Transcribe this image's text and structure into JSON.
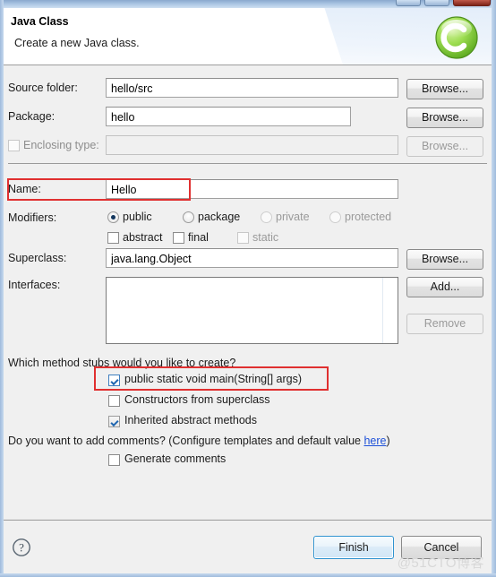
{
  "window": {
    "titlebar_buttons": [
      "minimize",
      "maximize",
      "close"
    ]
  },
  "header": {
    "title": "Java Class",
    "subtitle": "Create a new Java class.",
    "icon": "green-c-class-icon"
  },
  "form": {
    "source_folder": {
      "label": "Source folder:",
      "value": "hello/src",
      "browse_label": "Browse..."
    },
    "package": {
      "label": "Package:",
      "value": "hello",
      "browse_label": "Browse..."
    },
    "enclosing_type": {
      "label": "Enclosing type:",
      "value": "",
      "checked": false,
      "enabled": false,
      "browse_label": "Browse..."
    },
    "name": {
      "label": "Name:",
      "value": "Hello"
    },
    "modifiers": {
      "label": "Modifiers:",
      "radios": [
        {
          "label": "public",
          "selected": true,
          "enabled": true
        },
        {
          "label": "package",
          "selected": false,
          "enabled": true
        },
        {
          "label": "private",
          "selected": false,
          "enabled": false
        },
        {
          "label": "protected",
          "selected": false,
          "enabled": false
        }
      ],
      "checkboxes": [
        {
          "label": "abstract",
          "checked": false,
          "enabled": true
        },
        {
          "label": "final",
          "checked": false,
          "enabled": true
        },
        {
          "label": "static",
          "checked": false,
          "enabled": false
        }
      ]
    },
    "superclass": {
      "label": "Superclass:",
      "value": "java.lang.Object",
      "browse_label": "Browse..."
    },
    "interfaces": {
      "label": "Interfaces:",
      "items": [],
      "add_label": "Add...",
      "remove_label": "Remove"
    },
    "method_stubs": {
      "question": "Which method stubs would you like to create?",
      "options": [
        {
          "label": "public static void main(String[] args)",
          "checked": true,
          "enabled": true
        },
        {
          "label": "Constructors from superclass",
          "checked": false,
          "enabled": true
        },
        {
          "label": "Inherited abstract methods",
          "checked": true,
          "enabled": false
        }
      ]
    },
    "comments": {
      "question_prefix": "Do you want to add comments? (Configure templates and default value ",
      "link": "here",
      "question_suffix": ")",
      "option": {
        "label": "Generate comments",
        "checked": false,
        "enabled": true
      }
    }
  },
  "footer": {
    "help_icon": "question-mark-icon",
    "finish_label": "Finish",
    "cancel_label": "Cancel"
  },
  "watermark": "@51CTO博客",
  "colors": {
    "accent_blue": "#2f93d0",
    "link_blue": "#1c4fd8",
    "annotation_red": "#e03030",
    "icon_green": "#7ac943",
    "dialog_bg": "#f0f0f0"
  }
}
